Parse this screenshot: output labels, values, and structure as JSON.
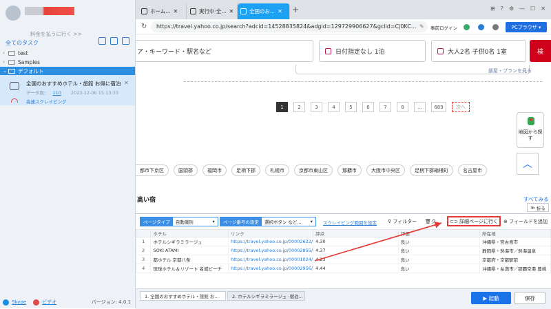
{
  "sidebar": {
    "pay_link": "料金を払うに行く >>",
    "tasks_title": "全てのタスク",
    "tree": [
      {
        "label": "test"
      },
      {
        "label": "Samples"
      },
      {
        "label": "デフォルト"
      }
    ],
    "task": {
      "name": "全国のおすすめホテル・旅館 お得に宿泊予…",
      "count_label": "データ数：",
      "count": "110",
      "date": "2023-12-06 15:13:33",
      "mode": "高速スクレイピング"
    },
    "footer": {
      "skype": "Skype",
      "video": "ビデオ",
      "version": "バージョン: 4.0.1"
    }
  },
  "browser": {
    "tabs": [
      {
        "label": "ホーム..."
      },
      {
        "label": "実行中·全..."
      },
      {
        "label": "全国のお..."
      }
    ],
    "url": "https://travel.yahoo.co.jp/search?adcid=14528835824&adgid=129729906627&gclid=Cj0KC...",
    "login": "事前ログイン",
    "pc_browser": "PCブラウザ"
  },
  "page": {
    "area_input": "ア・キーワード・駅名など",
    "date_input": "日付指定なし 1泊",
    "people_input": "大人2名 子供0名 1室",
    "search_btn": "検",
    "plan_hint": "部屋・プランを見る",
    "pages": [
      "1",
      "2",
      "3",
      "4",
      "5",
      "6",
      "7",
      "8",
      "...",
      "689",
      "次へ"
    ],
    "map_btn": "地図から探す",
    "chips": [
      "都市下京区",
      "国頭郡",
      "福岡市",
      "足柄下郡",
      "札幌市",
      "京都市東山区",
      "那覇市",
      "大阪市中央区",
      "足柄下郡箱根町",
      "名古屋市"
    ],
    "popular": "高い宿",
    "see_all": "すべてみる",
    "fold": "折る"
  },
  "panel": {
    "page_type_key": "ページタイプ",
    "page_type_val": "自動識別",
    "page_num_key": "ページ番号の設定",
    "page_num_val": "選択ボタン など...",
    "scrape_range": "スクレイピング範囲を設定",
    "filter": "フィルター",
    "clear": "ク",
    "detail": "詳細ページに行く",
    "add_field": "フィールドを追加",
    "columns": [
      "",
      "ホテル",
      "リンク",
      "評点",
      "評価",
      "所在地"
    ],
    "rows": [
      [
        "1",
        "ホテルシギラミラージュ",
        "https://travel.yahoo.co.jp/00002622/",
        "4.30",
        "良い",
        "沖縄県・宮古島市"
      ],
      [
        "2",
        "SOKI ATAMI",
        "https://travel.yahoo.co.jp/00002855/",
        "4.37",
        "良い",
        "静岡県・熱海市／熱海温泉"
      ],
      [
        "3",
        "都ホテル 京都八条",
        "https://travel.yahoo.co.jp/00001024/",
        "4.23",
        "良い",
        "京都府・京都駅前"
      ],
      [
        "4",
        "琉球ホテル＆リゾート 名城ビーチ",
        "https://travel.yahoo.co.jp/00002956/",
        "4.44",
        "良い",
        "沖縄県・糸満市／那覇空港 豊崎"
      ]
    ],
    "sheets": [
      "1. 全国のおすすめホテル・旅館 お...",
      "2. ホテルシギラミラージュ -宿泊..."
    ],
    "start": "起動",
    "save": "保存"
  }
}
